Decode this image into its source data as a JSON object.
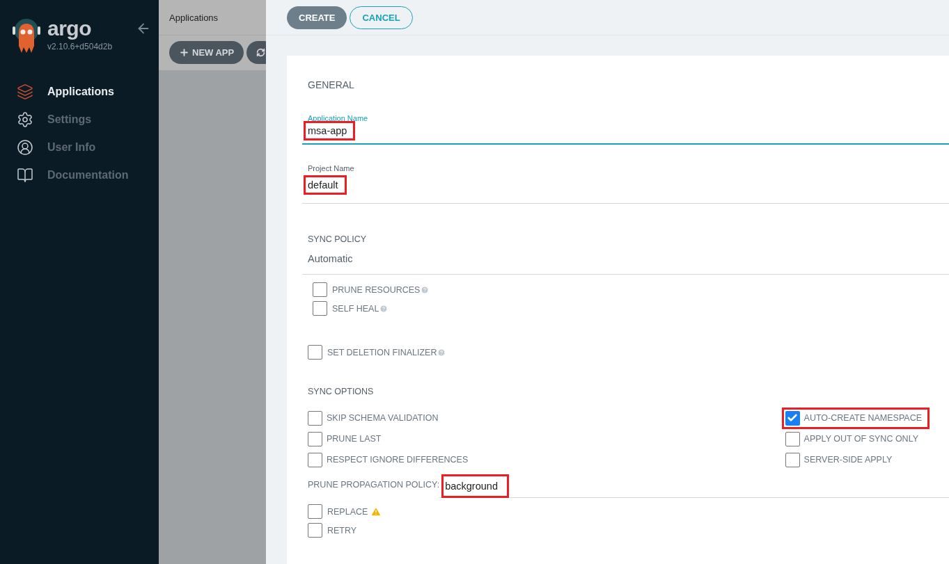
{
  "sidebar": {
    "logo_text": "argo",
    "version": "v2.10.6+d504d2b",
    "items": [
      {
        "label": "Applications",
        "selected": true
      },
      {
        "label": "Settings",
        "selected": false
      },
      {
        "label": "User Info",
        "selected": false
      },
      {
        "label": "Documentation",
        "selected": false
      }
    ]
  },
  "apps_panel": {
    "title": "Applications",
    "buttons": [
      {
        "label": "NEW APP"
      }
    ]
  },
  "toolbar": {
    "buttons": [
      {
        "label": "CREATE",
        "kind": "filled"
      },
      {
        "label": "CANCEL",
        "kind": "outline"
      }
    ]
  },
  "form": {
    "section_general": "GENERAL",
    "fields": [
      {
        "label": "Application Name",
        "value": "msa-app",
        "focused": true,
        "highlighted": true
      },
      {
        "label": "Project Name",
        "value": "default",
        "focused": false,
        "highlighted": true
      }
    ],
    "section_sync_policy": "SYNC POLICY",
    "sync_policy": {
      "value": "Automatic"
    },
    "policy_options": [
      {
        "label": "PRUNE RESOURCES",
        "checked": false,
        "help": true
      },
      {
        "label": "SELF HEAL",
        "checked": false,
        "help": true
      }
    ],
    "deletion_finalizer": {
      "label": "SET DELETION FINALIZER",
      "checked": false,
      "help": true
    },
    "section_sync_options": "SYNC OPTIONS",
    "sync_options_left": [
      {
        "label": "SKIP SCHEMA VALIDATION",
        "checked": false,
        "highlighted": false
      },
      {
        "label": "PRUNE LAST",
        "checked": false,
        "highlighted": false
      },
      {
        "label": "RESPECT IGNORE DIFFERENCES",
        "checked": false,
        "highlighted": false
      }
    ],
    "sync_options_right": [
      {
        "label": "AUTO-CREATE NAMESPACE",
        "checked": true,
        "highlighted": true
      },
      {
        "label": "APPLY OUT OF SYNC ONLY",
        "checked": false,
        "highlighted": false
      },
      {
        "label": "SERVER-SIDE APPLY",
        "checked": false,
        "highlighted": false
      }
    ],
    "prune_propagation": {
      "label": "PRUNE PROPAGATION POLICY:",
      "value": "background",
      "highlighted": true
    },
    "bottom_options": [
      {
        "label": "REPLACE",
        "checked": false,
        "warning": true
      },
      {
        "label": "RETRY",
        "checked": false,
        "warning": false
      }
    ]
  }
}
